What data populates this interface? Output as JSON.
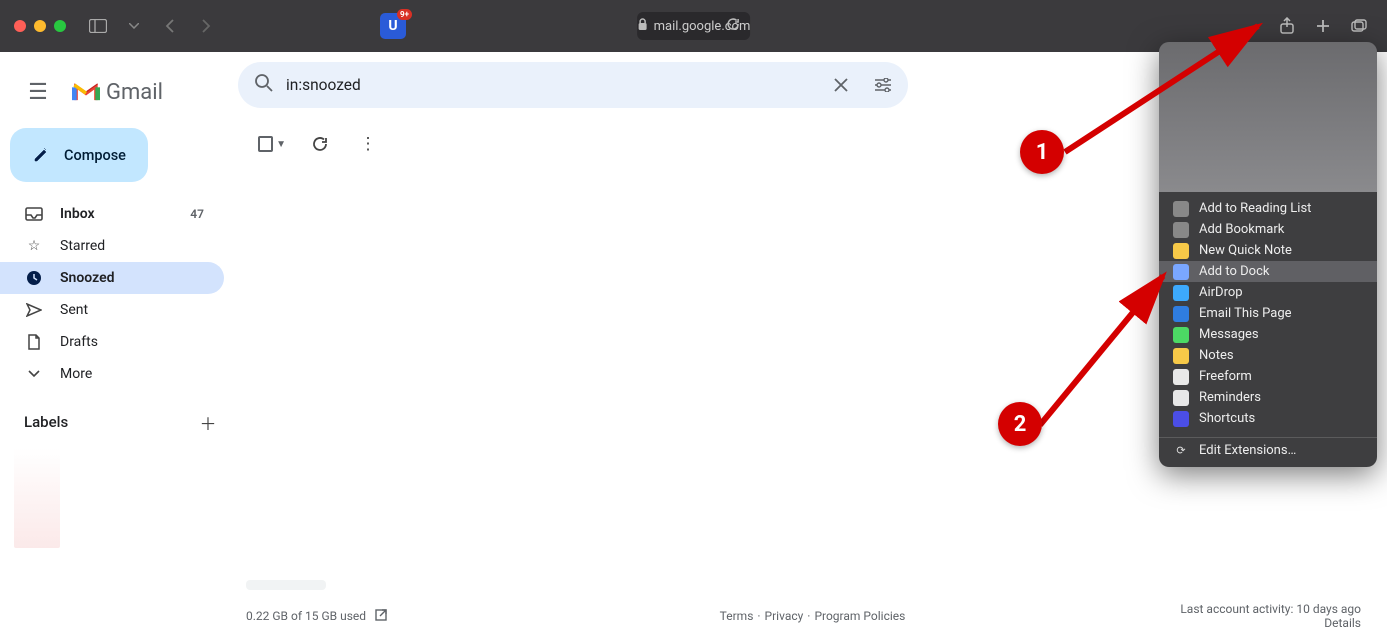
{
  "browser": {
    "url_host": "mail.google.com",
    "extension_letter": "U"
  },
  "gmail": {
    "brand": "Gmail",
    "compose_label": "Compose",
    "search_value": "in:snoozed",
    "nav": [
      {
        "icon": "inbox",
        "label": "Inbox",
        "count": "47",
        "bold": true
      },
      {
        "icon": "star",
        "label": "Starred"
      },
      {
        "icon": "clock",
        "label": "Snoozed",
        "active": true
      },
      {
        "icon": "send",
        "label": "Sent"
      },
      {
        "icon": "file",
        "label": "Drafts"
      },
      {
        "icon": "chev",
        "label": "More"
      }
    ],
    "labels_header": "Labels"
  },
  "footer": {
    "storage": "0.22 GB of 15 GB used",
    "terms": "Terms",
    "privacy": "Privacy",
    "policies": "Program Policies",
    "activity": "Last account activity: 10 days ago",
    "details": "Details"
  },
  "share_menu": {
    "items": [
      {
        "label": "Add to Reading List",
        "color": "#888"
      },
      {
        "label": "Add Bookmark",
        "color": "#888"
      },
      {
        "label": "New Quick Note",
        "color": "#f7c948"
      },
      {
        "label": "Add to Dock",
        "color": "#7aa7ff",
        "highlight": true
      },
      {
        "label": "AirDrop",
        "color": "#3da9fc"
      },
      {
        "label": "Email This Page",
        "color": "#2f7de0"
      },
      {
        "label": "Messages",
        "color": "#4cd964"
      },
      {
        "label": "Notes",
        "color": "#f7c948"
      },
      {
        "label": "Freeform",
        "color": "#e8e8e8"
      },
      {
        "label": "Reminders",
        "color": "#e8e8e8"
      },
      {
        "label": "Shortcuts",
        "color": "#4b4ee6"
      }
    ],
    "edit": "Edit Extensions…"
  },
  "annotations": {
    "one": "1",
    "two": "2"
  }
}
